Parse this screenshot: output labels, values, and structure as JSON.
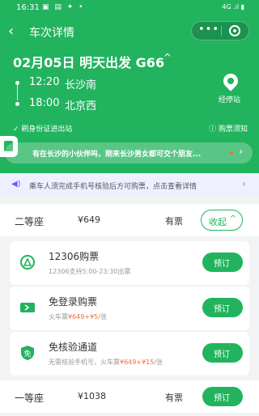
{
  "status_bar": {
    "time": "16:31",
    "left_icons": "▣ ▤ ✦ •",
    "right_icons": "4G .ıl ▮"
  },
  "nav": {
    "title": "车次详情",
    "menu_dots": "•••"
  },
  "trip": {
    "title": "02月05日 明天出发 G66",
    "caret": "^",
    "departure": {
      "time": "12:20",
      "station": "长沙南"
    },
    "arrival": {
      "time": "18:00",
      "station": "北京西"
    },
    "stops_label": "经停站",
    "id_note": "刷身份证进出站",
    "notice_link": "ⓘ 购票须知"
  },
  "banner": {
    "text": "有在长沙的小伙伴吗，刚来长沙男女都可交个朋友..."
  },
  "notice": {
    "text": "乘车人须完成手机号核验后方可购票，点击查看详情"
  },
  "seats": [
    {
      "name": "二等座",
      "price": "¥649",
      "avail": "有票",
      "action": "收起"
    },
    {
      "name": "一等座",
      "price": "¥1038",
      "avail": "有票",
      "action": "预订"
    }
  ],
  "options": [
    {
      "title": "12306购票",
      "sub": "12306支持5:00-23:30出票",
      "sub_hl": "",
      "sub_tail": "",
      "action": "预订"
    },
    {
      "title": "免登录购票",
      "sub": "火车票",
      "sub_hl": "¥649+¥5",
      "sub_tail": "/张",
      "action": "预订"
    },
    {
      "title": "免核验通道",
      "sub": "无需核验手机号，火车票",
      "sub_hl": "¥649+¥15",
      "sub_tail": "/张",
      "action": "预订"
    }
  ],
  "colors": {
    "primary": "#22b35e",
    "accent": "#f06b3b",
    "notice_bg": "#eef0ff"
  }
}
